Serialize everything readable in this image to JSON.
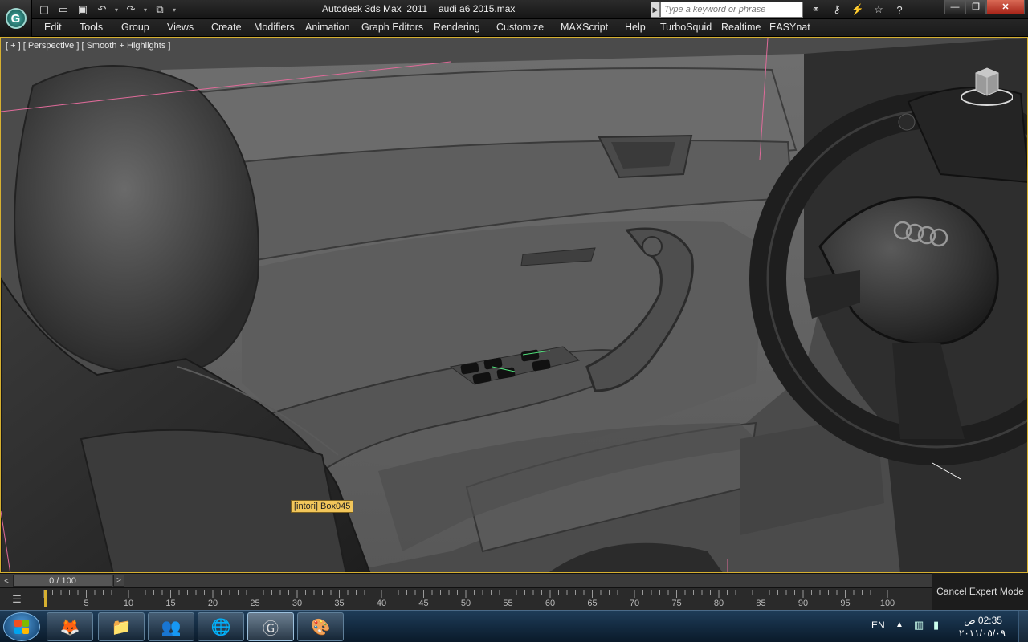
{
  "window": {
    "app_title": "Autodesk 3ds Max  2011",
    "file_name": "audi a6 2015.max",
    "app_logo": "3ds-max-logo",
    "controls": {
      "minimize": "—",
      "maximize": "❐",
      "close": "✕"
    }
  },
  "quick_access": {
    "icons": [
      "new-file-icon",
      "open-file-icon",
      "save-icon",
      "undo-icon",
      "redo-icon",
      "project-folder-icon"
    ]
  },
  "search": {
    "placeholder": "Type a keyword or phrase"
  },
  "info_center": {
    "icons": [
      "binoculars-icon",
      "key-icon",
      "satellite-icon",
      "star-icon",
      "help-icon"
    ]
  },
  "menu": {
    "items": [
      "Edit",
      "Tools",
      "Group",
      "Views",
      "Create",
      "Modifiers",
      "Animation",
      "Graph Editors",
      "Rendering",
      "Customize",
      "MAXScript",
      "Help",
      "TurboSquid",
      "Realtime",
      "EASYnat"
    ]
  },
  "viewport": {
    "label": "[ + ] [ Perspective ] [ Smooth + Highlights ]",
    "tooltip": "[intori] Box045",
    "steering_emblem": "audi-rings"
  },
  "time_slider": {
    "frame_display": "0 / 100",
    "current": 0,
    "end": 100,
    "prev_glyph": "<",
    "next_glyph": ">"
  },
  "track_bar": {
    "tick_labels": [
      "5",
      "10",
      "15",
      "20",
      "25",
      "30",
      "35",
      "40",
      "45",
      "50",
      "55",
      "60",
      "65",
      "70",
      "75",
      "80",
      "85",
      "90",
      "95",
      "100"
    ]
  },
  "status": {
    "cancel_expert_mode": "Cancel Expert Mode"
  },
  "taskbar": {
    "start_icon": "windows-start-icon",
    "apps": [
      "firefox-icon",
      "file-explorer-icon",
      "messenger-icon",
      "internet-download-manager-icon",
      "3ds-max-icon",
      "paint-icon"
    ],
    "tray": {
      "language": "EN",
      "time": "02:35 ص",
      "date": "٢٠١١/٠٥/٠٩"
    }
  },
  "colors": {
    "accent_border": "#d6b030",
    "tooltip_bg": "#f2c65a",
    "close_button": "#c8402e",
    "taskbar": "#123049"
  }
}
